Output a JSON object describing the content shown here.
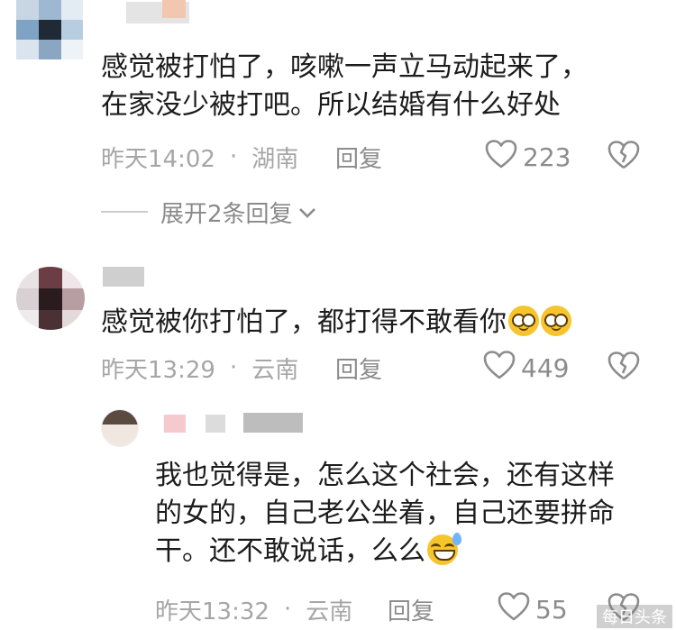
{
  "comments": [
    {
      "text_lines": [
        "感觉被打怕了，咳嗽一声立马动起来了，",
        "在家没少被打吧。所以结婚有什么好处"
      ],
      "time": "昨天14:02",
      "separator": "·",
      "location": "湖南",
      "reply_label": "回复",
      "likes": "223"
    },
    {
      "text": "感觉被你打怕了，都打得不敢看你",
      "time": "昨天13:29",
      "separator": "·",
      "location": "云南",
      "reply_label": "回复",
      "likes": "449"
    }
  ],
  "expand_replies": "展开2条回复",
  "reply": {
    "text_lines": [
      "我也觉得是，怎么这个社会，还有这样",
      "的女的，自己老公坐着，自己还要拼命",
      "干。还不敢说话，么么"
    ],
    "time": "昨天13:32",
    "separator": "·",
    "location": "云南",
    "reply_label": "回复",
    "likes": "55"
  },
  "watermark": "每日头条",
  "icons": {
    "like": "heart-outline-icon",
    "dislike": "broken-heart-icon",
    "expand": "chevron-down-icon",
    "emoji_1": "smiling-face-emoji",
    "emoji_2": "grinning-sweat-emoji"
  },
  "colors": {
    "text": "#1c1c1c",
    "meta": "#a6a6a6",
    "action": "#8c8c8c"
  }
}
